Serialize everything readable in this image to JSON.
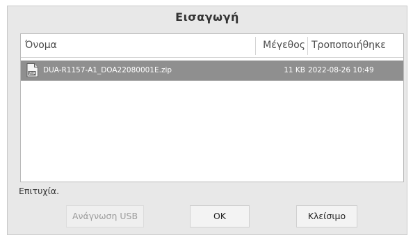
{
  "dialog": {
    "title": "Εισαγωγή"
  },
  "file_list": {
    "columns": {
      "name": "Όνομα",
      "size": "Μέγεθος",
      "modified": "Τροποποιήθηκε"
    },
    "rows": [
      {
        "icon": "zip-file-icon",
        "name": "DUA-R1157-A1_DOA22080001E.zip",
        "size": "11 KB",
        "modified": "2022-08-26 10:49",
        "selected": true
      }
    ]
  },
  "status": {
    "text": "Επιτυχία."
  },
  "buttons": {
    "usb_label": "Ανάγνωση USB",
    "usb_disabled": true,
    "ok_label": "OK",
    "close_label": "Κλείσιμο"
  },
  "colors": {
    "dialog_bg": "#e8e8e8",
    "selected_row_bg": "#8f8f8f",
    "selected_row_text": "#ffffff",
    "disabled_text": "#9c9c9c"
  }
}
